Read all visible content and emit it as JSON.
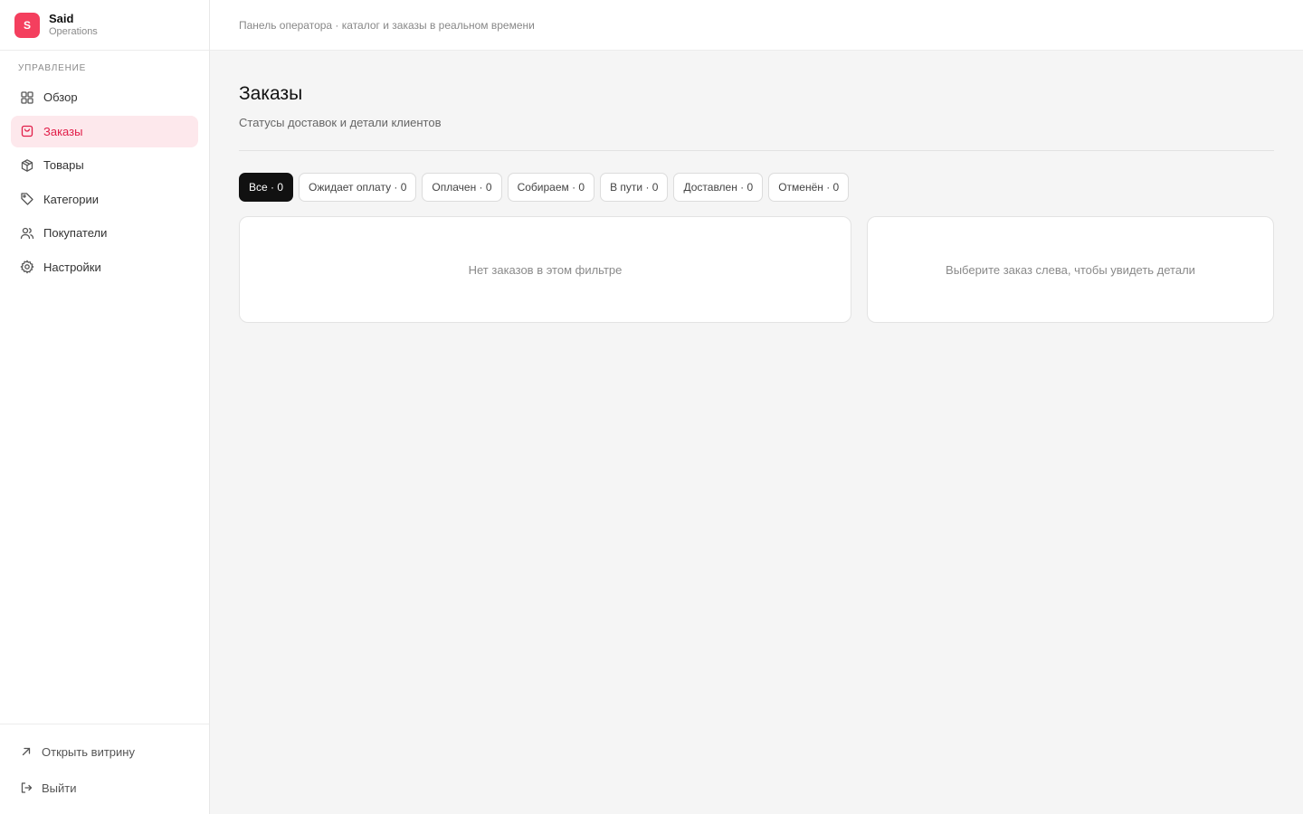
{
  "brand": {
    "logo_letter": "S",
    "name": "Said",
    "subtitle": "Operations"
  },
  "sidebar": {
    "section_label": "УПРАВЛЕНИЕ",
    "items": [
      {
        "label": "Обзор",
        "icon": "grid-icon",
        "active": false
      },
      {
        "label": "Заказы",
        "icon": "shopping-bag-icon",
        "active": true
      },
      {
        "label": "Товары",
        "icon": "box-icon",
        "active": false
      },
      {
        "label": "Категории",
        "icon": "tag-icon",
        "active": false
      },
      {
        "label": "Покупатели",
        "icon": "users-icon",
        "active": false
      },
      {
        "label": "Настройки",
        "icon": "gear-icon",
        "active": false
      }
    ],
    "bottom": {
      "open_store": "Открыть витрину",
      "logout": "Выйти"
    }
  },
  "topbar": {
    "text": "Панель оператора · каталог и заказы в реальном времени"
  },
  "page": {
    "title": "Заказы",
    "subtitle": "Статусы доставок и детали клиентов"
  },
  "filters": [
    {
      "label": "Все · 0",
      "active": true
    },
    {
      "label": "Ожидает оплату · 0",
      "active": false
    },
    {
      "label": "Оплачен · 0",
      "active": false
    },
    {
      "label": "Собираем · 0",
      "active": false
    },
    {
      "label": "В пути · 0",
      "active": false
    },
    {
      "label": "Доставлен · 0",
      "active": false
    },
    {
      "label": "Отменён · 0",
      "active": false
    }
  ],
  "panels": {
    "orders_empty": "Нет заказов в этом фильтре",
    "details_empty": "Выберите заказ слева, чтобы увидеть детали"
  },
  "colors": {
    "accent": "#e11d48",
    "accent_bg": "#fde8ec",
    "logo_bg": "#f43f5e"
  }
}
